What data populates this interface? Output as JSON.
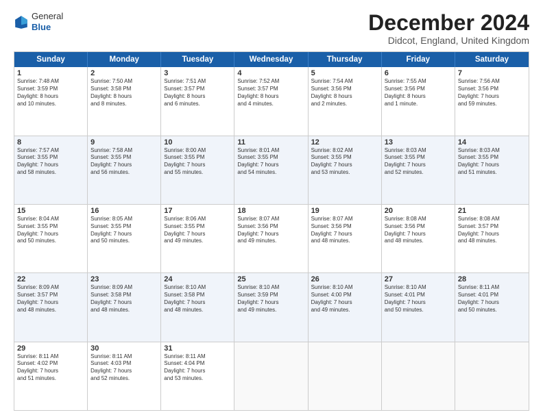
{
  "logo": {
    "general": "General",
    "blue": "Blue"
  },
  "title": "December 2024",
  "subtitle": "Didcot, England, United Kingdom",
  "headers": [
    "Sunday",
    "Monday",
    "Tuesday",
    "Wednesday",
    "Thursday",
    "Friday",
    "Saturday"
  ],
  "rows": [
    [
      {
        "day": "1",
        "lines": [
          "Sunrise: 7:48 AM",
          "Sunset: 3:59 PM",
          "Daylight: 8 hours",
          "and 10 minutes."
        ]
      },
      {
        "day": "2",
        "lines": [
          "Sunrise: 7:50 AM",
          "Sunset: 3:58 PM",
          "Daylight: 8 hours",
          "and 8 minutes."
        ]
      },
      {
        "day": "3",
        "lines": [
          "Sunrise: 7:51 AM",
          "Sunset: 3:57 PM",
          "Daylight: 8 hours",
          "and 6 minutes."
        ]
      },
      {
        "day": "4",
        "lines": [
          "Sunrise: 7:52 AM",
          "Sunset: 3:57 PM",
          "Daylight: 8 hours",
          "and 4 minutes."
        ]
      },
      {
        "day": "5",
        "lines": [
          "Sunrise: 7:54 AM",
          "Sunset: 3:56 PM",
          "Daylight: 8 hours",
          "and 2 minutes."
        ]
      },
      {
        "day": "6",
        "lines": [
          "Sunrise: 7:55 AM",
          "Sunset: 3:56 PM",
          "Daylight: 8 hours",
          "and 1 minute."
        ]
      },
      {
        "day": "7",
        "lines": [
          "Sunrise: 7:56 AM",
          "Sunset: 3:56 PM",
          "Daylight: 7 hours",
          "and 59 minutes."
        ]
      }
    ],
    [
      {
        "day": "8",
        "lines": [
          "Sunrise: 7:57 AM",
          "Sunset: 3:55 PM",
          "Daylight: 7 hours",
          "and 58 minutes."
        ]
      },
      {
        "day": "9",
        "lines": [
          "Sunrise: 7:58 AM",
          "Sunset: 3:55 PM",
          "Daylight: 7 hours",
          "and 56 minutes."
        ]
      },
      {
        "day": "10",
        "lines": [
          "Sunrise: 8:00 AM",
          "Sunset: 3:55 PM",
          "Daylight: 7 hours",
          "and 55 minutes."
        ]
      },
      {
        "day": "11",
        "lines": [
          "Sunrise: 8:01 AM",
          "Sunset: 3:55 PM",
          "Daylight: 7 hours",
          "and 54 minutes."
        ]
      },
      {
        "day": "12",
        "lines": [
          "Sunrise: 8:02 AM",
          "Sunset: 3:55 PM",
          "Daylight: 7 hours",
          "and 53 minutes."
        ]
      },
      {
        "day": "13",
        "lines": [
          "Sunrise: 8:03 AM",
          "Sunset: 3:55 PM",
          "Daylight: 7 hours",
          "and 52 minutes."
        ]
      },
      {
        "day": "14",
        "lines": [
          "Sunrise: 8:03 AM",
          "Sunset: 3:55 PM",
          "Daylight: 7 hours",
          "and 51 minutes."
        ]
      }
    ],
    [
      {
        "day": "15",
        "lines": [
          "Sunrise: 8:04 AM",
          "Sunset: 3:55 PM",
          "Daylight: 7 hours",
          "and 50 minutes."
        ]
      },
      {
        "day": "16",
        "lines": [
          "Sunrise: 8:05 AM",
          "Sunset: 3:55 PM",
          "Daylight: 7 hours",
          "and 50 minutes."
        ]
      },
      {
        "day": "17",
        "lines": [
          "Sunrise: 8:06 AM",
          "Sunset: 3:55 PM",
          "Daylight: 7 hours",
          "and 49 minutes."
        ]
      },
      {
        "day": "18",
        "lines": [
          "Sunrise: 8:07 AM",
          "Sunset: 3:56 PM",
          "Daylight: 7 hours",
          "and 49 minutes."
        ]
      },
      {
        "day": "19",
        "lines": [
          "Sunrise: 8:07 AM",
          "Sunset: 3:56 PM",
          "Daylight: 7 hours",
          "and 48 minutes."
        ]
      },
      {
        "day": "20",
        "lines": [
          "Sunrise: 8:08 AM",
          "Sunset: 3:56 PM",
          "Daylight: 7 hours",
          "and 48 minutes."
        ]
      },
      {
        "day": "21",
        "lines": [
          "Sunrise: 8:08 AM",
          "Sunset: 3:57 PM",
          "Daylight: 7 hours",
          "and 48 minutes."
        ]
      }
    ],
    [
      {
        "day": "22",
        "lines": [
          "Sunrise: 8:09 AM",
          "Sunset: 3:57 PM",
          "Daylight: 7 hours",
          "and 48 minutes."
        ]
      },
      {
        "day": "23",
        "lines": [
          "Sunrise: 8:09 AM",
          "Sunset: 3:58 PM",
          "Daylight: 7 hours",
          "and 48 minutes."
        ]
      },
      {
        "day": "24",
        "lines": [
          "Sunrise: 8:10 AM",
          "Sunset: 3:58 PM",
          "Daylight: 7 hours",
          "and 48 minutes."
        ]
      },
      {
        "day": "25",
        "lines": [
          "Sunrise: 8:10 AM",
          "Sunset: 3:59 PM",
          "Daylight: 7 hours",
          "and 49 minutes."
        ]
      },
      {
        "day": "26",
        "lines": [
          "Sunrise: 8:10 AM",
          "Sunset: 4:00 PM",
          "Daylight: 7 hours",
          "and 49 minutes."
        ]
      },
      {
        "day": "27",
        "lines": [
          "Sunrise: 8:10 AM",
          "Sunset: 4:01 PM",
          "Daylight: 7 hours",
          "and 50 minutes."
        ]
      },
      {
        "day": "28",
        "lines": [
          "Sunrise: 8:11 AM",
          "Sunset: 4:01 PM",
          "Daylight: 7 hours",
          "and 50 minutes."
        ]
      }
    ],
    [
      {
        "day": "29",
        "lines": [
          "Sunrise: 8:11 AM",
          "Sunset: 4:02 PM",
          "Daylight: 7 hours",
          "and 51 minutes."
        ]
      },
      {
        "day": "30",
        "lines": [
          "Sunrise: 8:11 AM",
          "Sunset: 4:03 PM",
          "Daylight: 7 hours",
          "and 52 minutes."
        ]
      },
      {
        "day": "31",
        "lines": [
          "Sunrise: 8:11 AM",
          "Sunset: 4:04 PM",
          "Daylight: 7 hours",
          "and 53 minutes."
        ]
      },
      {
        "day": "",
        "lines": []
      },
      {
        "day": "",
        "lines": []
      },
      {
        "day": "",
        "lines": []
      },
      {
        "day": "",
        "lines": []
      }
    ]
  ]
}
